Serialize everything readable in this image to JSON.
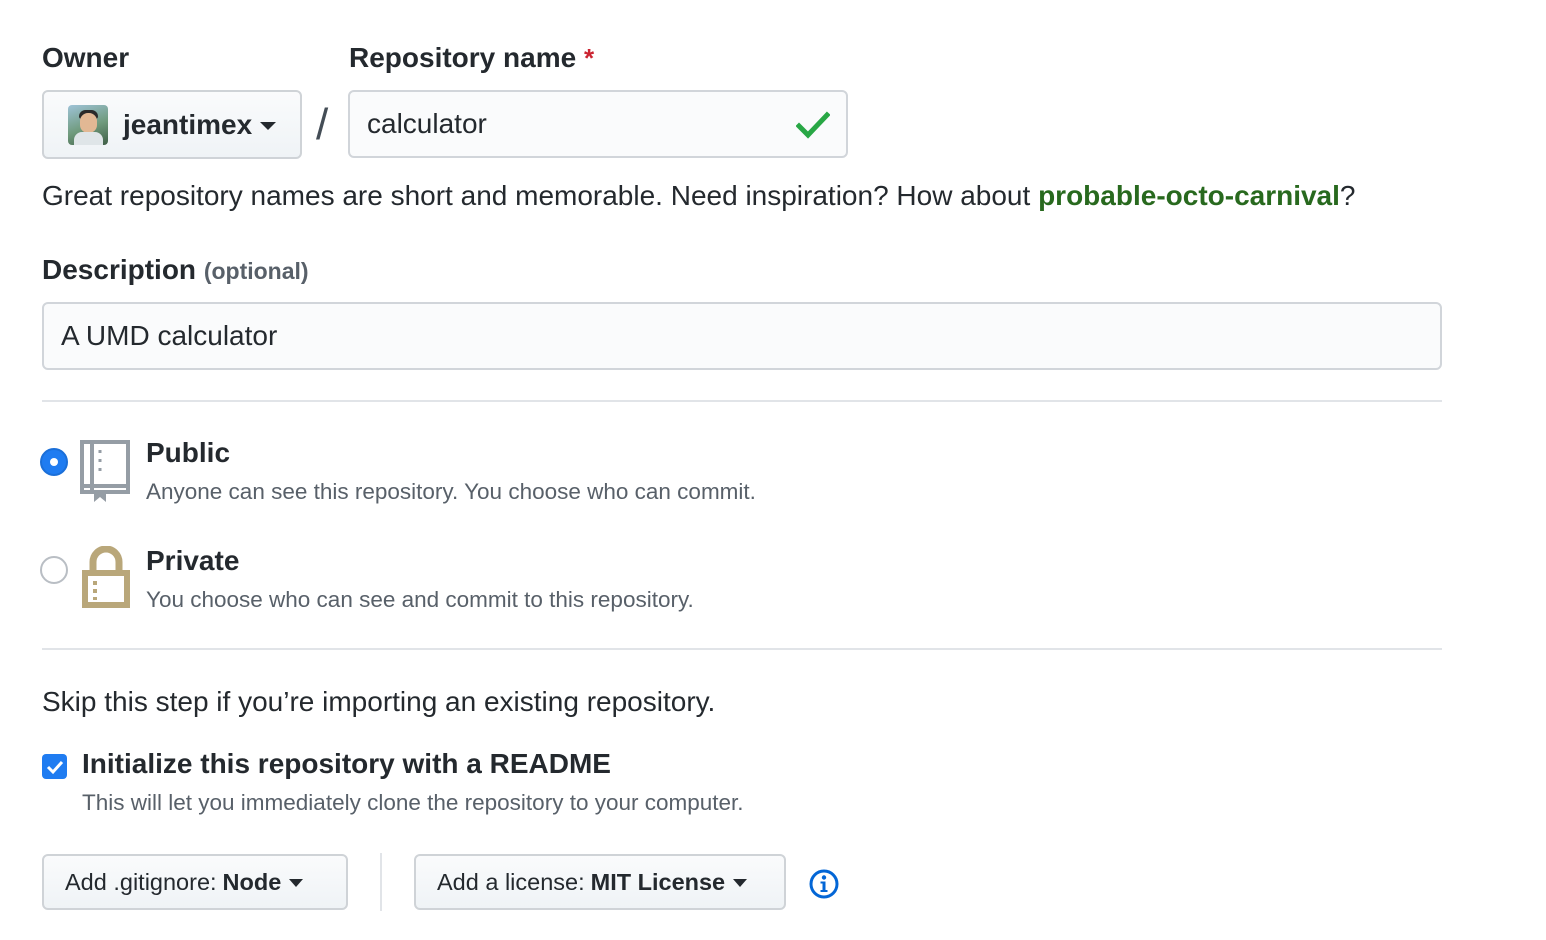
{
  "owner": {
    "label": "Owner",
    "name": "jeantimex"
  },
  "repo_name": {
    "label": "Repository name",
    "required_mark": "*",
    "value": "calculator"
  },
  "name_note": {
    "prefix": "Great repository names are short and memorable. Need inspiration? How about ",
    "suggestion": "probable-octo-carnival",
    "suffix": "?"
  },
  "description": {
    "label": "Description",
    "optional": "(optional)",
    "value": "A UMD calculator"
  },
  "visibility": {
    "public": {
      "title": "Public",
      "description": "Anyone can see this repository. You choose who can commit.",
      "selected": true
    },
    "private": {
      "title": "Private",
      "description": "You choose who can see and commit to this repository.",
      "selected": false
    }
  },
  "init": {
    "skip_note": "Skip this step if you’re importing an existing repository.",
    "readme_title": "Initialize this repository with a README",
    "readme_desc": "This will let you immediately clone the repository to your computer.",
    "readme_checked": true
  },
  "gitignore": {
    "label": "Add .gitignore:",
    "value": "Node"
  },
  "license": {
    "label": "Add a license:",
    "value": "MIT License"
  },
  "colors": {
    "accent": "#1f7cf1",
    "success": "#28a745",
    "suggestion": "#28691e",
    "required": "#cb2431"
  },
  "icons": [
    "check-icon",
    "repo-icon",
    "lock-icon",
    "checkbox-check-icon",
    "info-icon",
    "caret-down-icon"
  ]
}
